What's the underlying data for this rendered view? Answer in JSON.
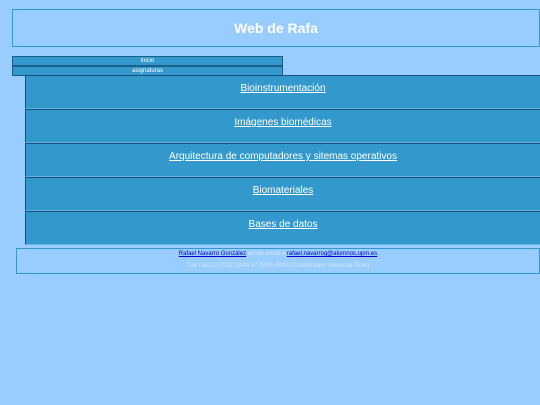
{
  "header": {
    "title": "Web de Rafa"
  },
  "nav": {
    "items": [
      {
        "label": "inicio"
      },
      {
        "label": "asignaturas"
      }
    ]
  },
  "subjects": [
    {
      "label": "Bioinstrumentación"
    },
    {
      "label": "Imágenes biomédicas"
    },
    {
      "label": "Arquitectura de computadores y sitemas operativos"
    },
    {
      "label": "Biomateriales"
    },
    {
      "label": "Bases de datos"
    }
  ],
  "footer": {
    "author_link": "Rafael Navarro González",
    "send_email_text": " enviar email a ",
    "email_link": "rafael.navarrog@alumnos.upm.es",
    "timestamp": "Tue Dec 12 2023 18:48:47 GMT+0000 (Coordinated Universal Time)"
  },
  "colors": {
    "background": "#99ccff",
    "panel": "#3399cc",
    "link": "#0000cc"
  }
}
